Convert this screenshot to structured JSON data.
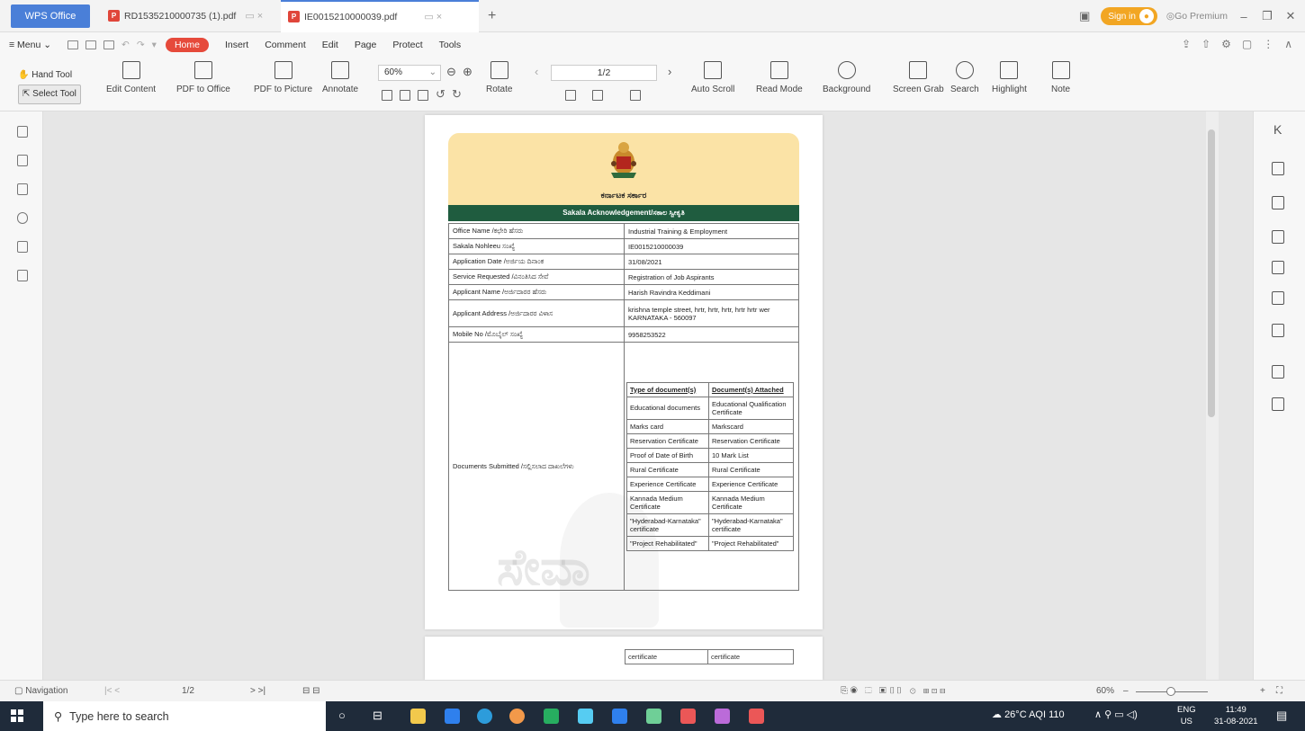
{
  "titlebar": {
    "app_tab": "WPS Office",
    "tabs": [
      {
        "label": "RD1535210000735 (1).pdf",
        "active": false
      },
      {
        "label": "IE0015210000039.pdf",
        "active": true
      }
    ],
    "sign_in": "Sign in",
    "go_premium": "Go Premium"
  },
  "menubar": {
    "menu": "Menu",
    "items": [
      "Home",
      "Insert",
      "Comment",
      "Edit",
      "Page",
      "Protect",
      "Tools"
    ]
  },
  "toolbar": {
    "hand_tool": "Hand Tool",
    "select_tool": "Select Tool",
    "edit_content": "Edit Content",
    "pdf_to_office": "PDF to Office",
    "pdf_to_picture": "PDF to Picture",
    "annotate": "Annotate",
    "zoom": "60%",
    "rotate": "Rotate",
    "page": "1/2",
    "auto_scroll": "Auto Scroll",
    "read_mode": "Read Mode",
    "background": "Background",
    "screen_grab": "Screen Grab",
    "search": "Search",
    "highlight": "Highlight",
    "note": "Note"
  },
  "document": {
    "gov_title": "ಕರ್ನಾಟಕ ಸರ್ಕಾರ",
    "ack_title": "Sakala Acknowledgement/ಸಕಾಲ ಸ್ವೀಕೃತಿ",
    "rows": [
      {
        "label": "Office Name /ಕಛೇರಿ ಹೆಸರು",
        "value": "Industrial Training & Employment"
      },
      {
        "label": "Sakala Nohleeu ಸಂಖ್ಯೆ",
        "value": "IE0015210000039"
      },
      {
        "label": "Application Date /ಅರ್ಜಿಯ ದಿನಾಂಕ",
        "value": "31/08/2021"
      },
      {
        "label": "Service Requested /ವಿನಂತಿಸಿದ ಸೇವೆ",
        "value": "Registration of Job Aspirants"
      },
      {
        "label": "Applicant Name /ಅರ್ಜಿದಾರರ ಹೆಸರು",
        "value": "Harish Ravindra Keddimani"
      },
      {
        "label": "Applicant Address /ಅರ್ಜಿದಾರರ ವಿಳಾಸ",
        "value": "krishna temple street, hrtr, hrtr, hrtr, hrtr hrtr wer KARNATAKA - 560097"
      },
      {
        "label": "Mobile No /ಮೊಬೈಲ್ ಸಂಖ್ಯೆ",
        "value": "9958253522"
      }
    ],
    "docs_label": "Documents Submitted /ಸಲ್ಲಿಸಲಾದ ದಾಖಲೆಗಳು",
    "docs_header": [
      "Type of document(s)",
      "Document(s) Attached"
    ],
    "docs": [
      [
        "Educational documents",
        "Educational Qualification Certificate"
      ],
      [
        "Marks card",
        "Markscard"
      ],
      [
        "Reservation Certificate",
        "Reservation Certificate"
      ],
      [
        "Proof of Date of Birth",
        "10 Mark List"
      ],
      [
        "Rural Certificate",
        "Rural Certificate"
      ],
      [
        "Experience Certificate",
        "Experience Certificate"
      ],
      [
        "Kannada Medium Certificate",
        "Kannada Medium Certificate"
      ],
      [
        "\"Hyderabad-Karnataka\" certificate",
        "\"Hyderabad-Karnataka\" certificate"
      ],
      [
        "\"Project Rehabilitated\"",
        "\"Project Rehabilitated\""
      ]
    ],
    "page2_cells": [
      "certificate",
      "certificate"
    ],
    "watermark": "ಸೇವಾ"
  },
  "statusbar": {
    "navigation": "Navigation",
    "page": "1/2",
    "zoom": "60%"
  },
  "taskbar": {
    "search_placeholder": "Type here to search",
    "weather": "26°C  AQI 110",
    "lang": "ENG",
    "region": "US",
    "time": "11:49",
    "date": "31-08-2021"
  }
}
